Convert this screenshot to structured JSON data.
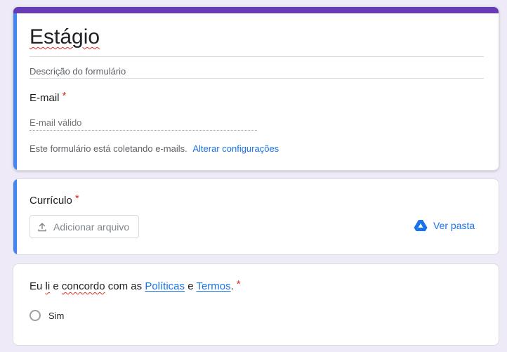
{
  "form": {
    "title": "Estágio",
    "description_placeholder": "Descrição do formulário"
  },
  "email_question": {
    "label": "E-mail",
    "required_mark": "*",
    "placeholder": "E-mail válido",
    "collect_note": "Este formulário está coletando e-mails.",
    "collect_link": "Alterar configurações"
  },
  "file_question": {
    "label": "Currículo",
    "required_mark": "*",
    "add_file_button": "Adicionar arquivo",
    "upload_icon": "upload-icon",
    "view_folder_link": "Ver pasta",
    "drive_icon": "google-drive-icon"
  },
  "terms_question": {
    "parts": [
      "Eu",
      "li",
      "e",
      "concordo",
      "com as",
      "Políticas",
      "e",
      "Termos",
      "."
    ],
    "required_mark": "*",
    "option": "Sim"
  },
  "colors": {
    "accent_purple": "#673ab7",
    "active_blue": "#4285f4",
    "link_blue": "#1a73e8",
    "required_red": "#d93025",
    "background": "#efeaf7"
  }
}
